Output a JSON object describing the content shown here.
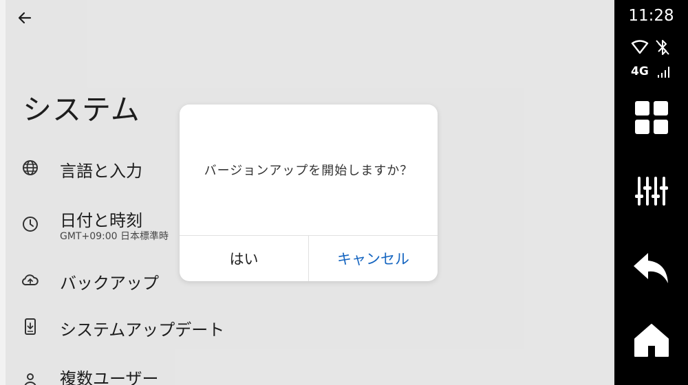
{
  "header": {
    "back_icon": "arrow-left-icon"
  },
  "page": {
    "title": "システム"
  },
  "settings": {
    "items": [
      {
        "icon": "globe-icon",
        "label": "言語と入力"
      },
      {
        "icon": "clock-icon",
        "label": "日付と時刻",
        "subtitle": "GMT+09:00 日本標準時"
      },
      {
        "icon": "cloud-upload-icon",
        "label": "バックアップ"
      },
      {
        "icon": "system-update-icon",
        "label": "システムアップデート"
      },
      {
        "icon": "person-icon",
        "label": "複数ユーザー"
      }
    ]
  },
  "dialog": {
    "message": "バージョンアップを開始しますか？",
    "confirm_label": "はい",
    "cancel_label": "キャンセル"
  },
  "status_bar": {
    "time": "11:28",
    "network_type": "4G",
    "icons": [
      "wifi-icon",
      "bluetooth-icon",
      "cell-signal-icon"
    ]
  },
  "rail": {
    "buttons": [
      "apps-grid-icon",
      "equalizer-icon",
      "back-arrow-icon",
      "home-icon"
    ]
  },
  "colors": {
    "accent": "#1565c0",
    "background": "#f2f2f2",
    "dialog": "#ffffff",
    "rail": "#000000"
  }
}
